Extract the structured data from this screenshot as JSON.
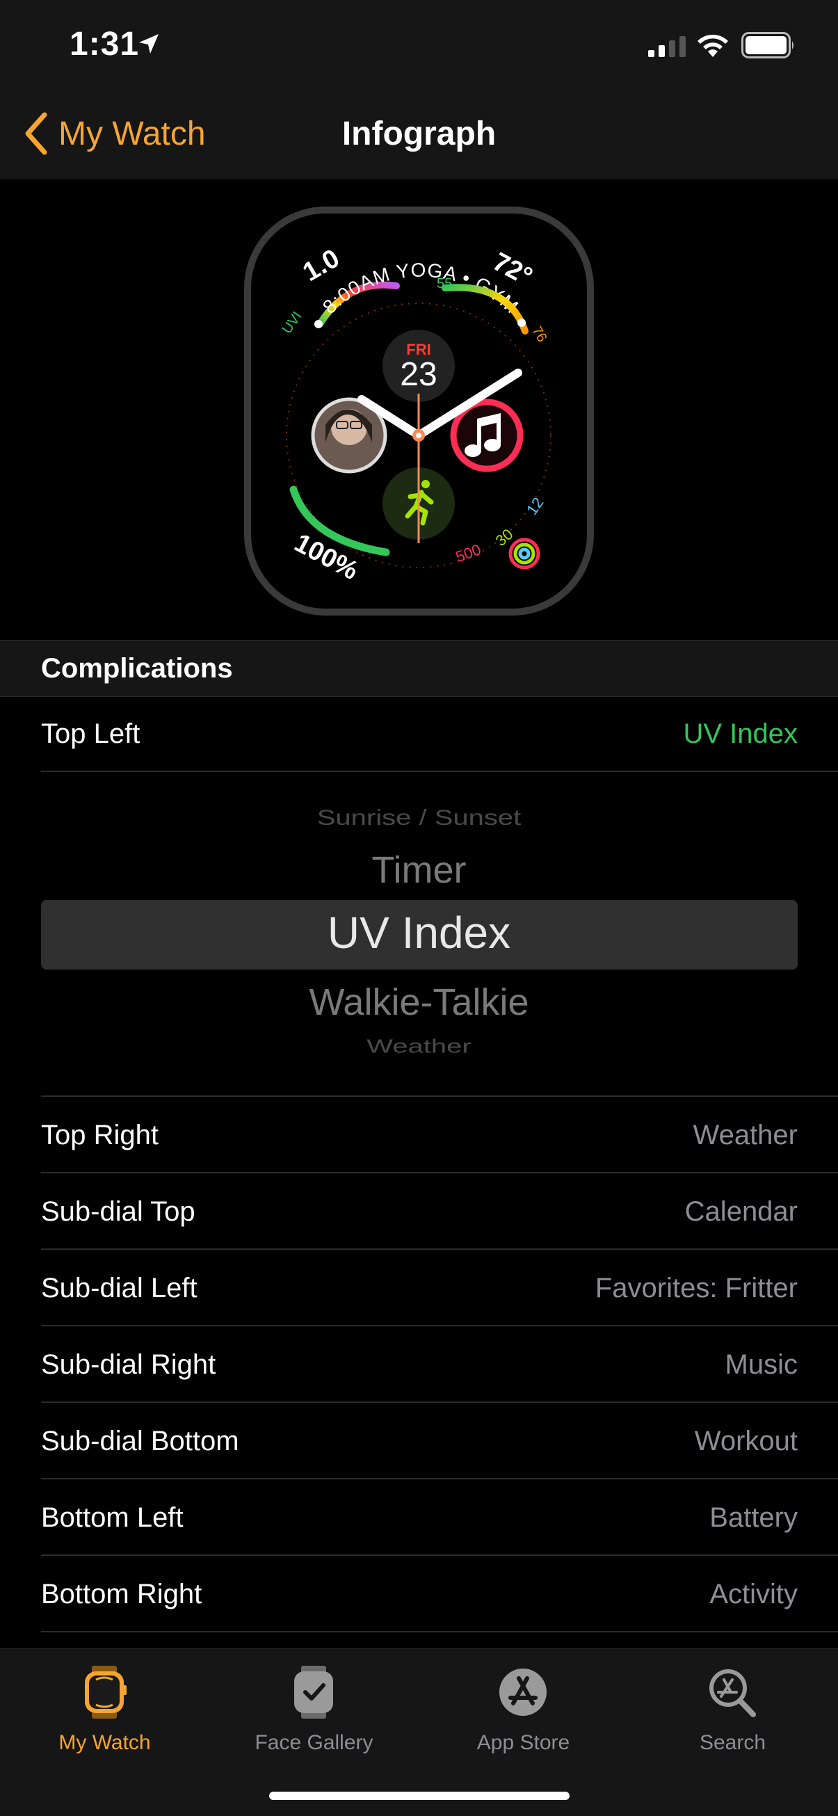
{
  "status_bar": {
    "time": "1:31"
  },
  "nav": {
    "back_label": "My Watch",
    "title": "Infograph"
  },
  "watch_face": {
    "uv_value": "1.0",
    "uv_label": "UVI",
    "calendar_event": "8:00AM YOGA • GYM",
    "temperature": "72°",
    "temp_low": "55",
    "temp_high": "76",
    "day": "FRI",
    "date": "23",
    "battery": "100%",
    "activity_move": "500",
    "activity_exercise": "30",
    "activity_stand": "12"
  },
  "complications_header": "Complications",
  "top_left": {
    "label": "Top Left",
    "value": "UV Index"
  },
  "picker": {
    "options": [
      "Sunrise / Sunset",
      "Timer",
      "UV Index",
      "Walkie-Talkie",
      "Weather"
    ],
    "selected": "UV Index"
  },
  "rows": [
    {
      "label": "Top Right",
      "value": "Weather"
    },
    {
      "label": "Sub-dial Top",
      "value": "Calendar"
    },
    {
      "label": "Sub-dial Left",
      "value": "Favorites: Fritter"
    },
    {
      "label": "Sub-dial Right",
      "value": "Music"
    },
    {
      "label": "Sub-dial Bottom",
      "value": "Workout"
    },
    {
      "label": "Bottom Left",
      "value": "Battery"
    },
    {
      "label": "Bottom Right",
      "value": "Activity"
    }
  ],
  "tabs": [
    {
      "label": "My Watch",
      "icon": "watch-icon",
      "active": true
    },
    {
      "label": "Face Gallery",
      "icon": "face-gallery-icon",
      "active": false
    },
    {
      "label": "App Store",
      "icon": "app-store-icon",
      "active": false
    },
    {
      "label": "Search",
      "icon": "search-icon",
      "active": false
    }
  ],
  "colors": {
    "accent": "#f7a531",
    "active_value": "#34c759",
    "secondary_text": "#8e8e93"
  }
}
